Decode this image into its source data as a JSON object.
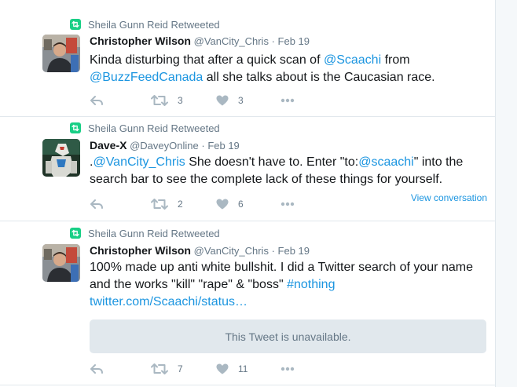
{
  "tweets": [
    {
      "retweet_context": "Sheila Gunn Reid Retweeted",
      "fullname": "Christopher Wilson",
      "username": "@VanCity_Chris",
      "sep": "·",
      "date": "Feb 19",
      "text_parts": [
        "Kinda disturbing that after a quick scan of ",
        "@Scaachi",
        " from ",
        "@BuzzFeedCanada",
        " all she talks about is the Caucasian race."
      ],
      "retweet_count": "3",
      "like_count": "3"
    },
    {
      "retweet_context": "Sheila Gunn Reid Retweeted",
      "fullname": "Dave-X",
      "username": "@DaveyOnline",
      "sep": "·",
      "date": "Feb 19",
      "text_parts": [
        ".",
        "@VanCity_Chris",
        " She doesn't have to. Enter \"to:",
        "@scaachi",
        "\" into the search bar to see the complete lack of these things for yourself."
      ],
      "retweet_count": "2",
      "like_count": "6",
      "view_conversation": "View conversation"
    },
    {
      "retweet_context": "Sheila Gunn Reid Retweeted",
      "fullname": "Christopher Wilson",
      "username": "@VanCity_Chris",
      "sep": "·",
      "date": "Feb 19",
      "text_parts": [
        "100% made up anti white bullshit. I did a Twitter search of your name and the works \"kill\" \"rape\" & \"boss\" ",
        "#nothing",
        " ",
        "twitter.com/Scaachi/status…"
      ],
      "unavailable": "This Tweet is unavailable.",
      "retweet_count": "7",
      "like_count": "11"
    }
  ],
  "icons": {
    "retweet_badge": "retweet-icon",
    "reply": "reply-icon",
    "retweet": "retweet-icon",
    "like": "heart-icon",
    "more": "more-dots-icon"
  },
  "colors": {
    "link": "#1b95e0",
    "secondary_text": "#657786",
    "retweet_green": "#19cf86",
    "icon_gray": "#aab8c2",
    "border": "#e1e8ed"
  }
}
